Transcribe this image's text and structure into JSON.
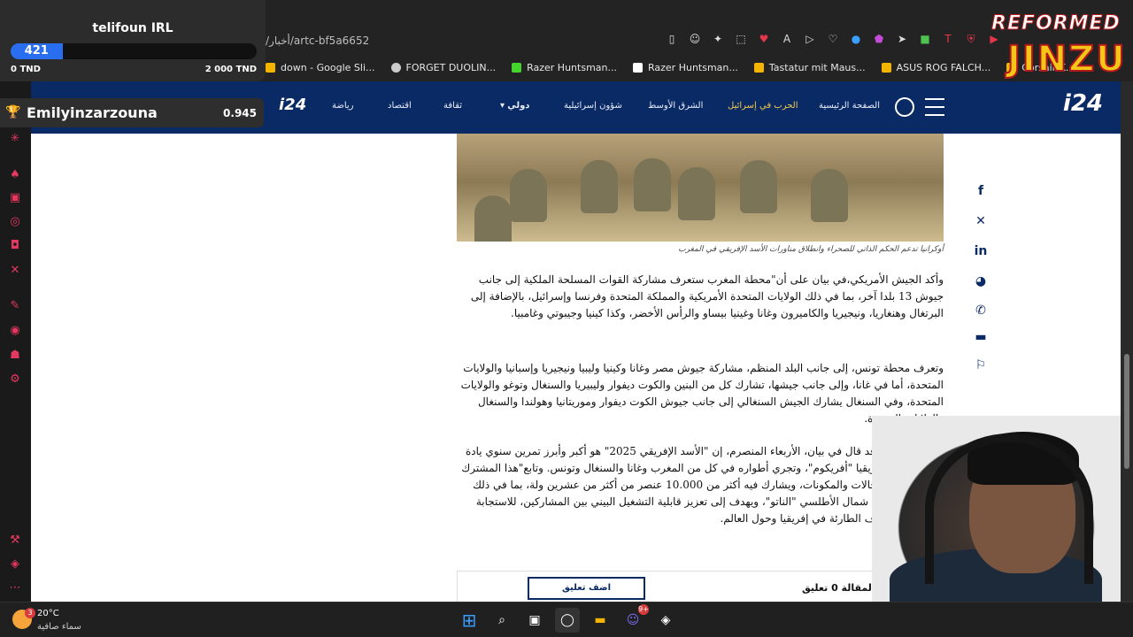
{
  "browser": {
    "address": "/أخبار/artc-bf5a6652",
    "bookmarks": [
      {
        "label": "down - Google Sli...",
        "color": "#f5b400"
      },
      {
        "label": "FORGET DUOLIN...",
        "color": "#cccccc"
      },
      {
        "label": "Razer Huntsman...",
        "color": "#44d62c"
      },
      {
        "label": "Razer Huntsman...",
        "color": "#ffffff"
      },
      {
        "label": "Tastatur mit Maus...",
        "color": "#f5b400"
      },
      {
        "label": "ASUS ROG FALCH...",
        "color": "#f5b400"
      },
      {
        "label": "Corsair K...",
        "color": "#f5b400"
      }
    ]
  },
  "sitenav": {
    "logo": "i24",
    "logo_small": "i24",
    "items": [
      {
        "label": "الصفحة الرئيسية",
        "active": false
      },
      {
        "label": "الحرب في إسرائيل",
        "active": true
      },
      {
        "label": "الشرق الأوسط",
        "active": false
      },
      {
        "label": "شؤون إسرائيلية",
        "active": false
      },
      {
        "label": "دولي",
        "active": false
      },
      {
        "label": "ثقافة",
        "active": false
      },
      {
        "label": "اقتصاد",
        "active": false
      },
      {
        "label": "رياضة",
        "active": false
      }
    ]
  },
  "article": {
    "caption": "أوكرانيا تدعم الحكم الذاتي للصحراء وانطلاق مناورات الأسد الإفريقي في المغرب",
    "paragraphs": [
      "وأكد الجيش الأمريكي،في بيان على أن\"محطة المغرب ستعرف مشاركة القوات المسلحة الملكية إلى جانب جيوش 13 بلدا آخر، بما في ذلك الولايات المتحدة الأمريكية والمملكة المتحدة وفرنسا وإسرائيل، بالإضافة إلى البرتغال وهنغاريا، ونيجيريا والكاميرون وغانا وغينيا بيساو والرأس الأخضر، وكذا كينيا وجيبوتي وغامبيا.",
      "وتعرف محطة تونس، إلى جانب البلد المنظم، مشاركة جيوش مصر وغانا وكينيا وليبيا ونيجيريا وإسبانيا والولايات المتحدة، أما في غانا، وإلى جانب جيشها، تشارك كل من البنين والكوت ديفوار وليبيريا والسنغال وتوغو والولايات المتحدة، وفي السنغال يشارك الجيش السنغالي إلى جانب جيوش الكوت ديفوار وموريتانيا وهولندا والسنغال والولايات المتحدة.",
      "جيش الأمريكي قد قال في بيان، الأربعاء المنصرم، إن \"الأسد الإفريقي 2025\" هو أكبر وأبرز تمرين سنوي يادة الأمريكية في إفريقيا \"أفريكوم\"، وتجري أطواره في كل من المغرب وغانا والسنغال وتونس. وتابع\"هذا المشترك يغطي جميع المجالات والمكونات، ويشارك فيه أكثر من 10.000 عنصر من أكثر من عشرين ولة، بما في ذلك وحدات من حلف شمال الأطلسي \"الناتو\"، ويهدف إلى تعزيز قابلية التشغيل البيني بين المشاركين، للاستجابة للأزمات والظروف الطارئة في إفريقيا وحول العالم."
    ],
    "comments": {
      "add_label": "اضف تعليق",
      "count_label": "تلقت هذه المقالة 0 تعليق"
    }
  },
  "share": [
    "facebook-icon",
    "x-icon",
    "linkedin-icon",
    "reddit-icon",
    "whatsapp-icon",
    "comment-icon",
    "bookmark-icon"
  ],
  "goal": {
    "title": "telifoun IRL",
    "current": "421",
    "fraction": 0.2105,
    "min_label": "0 TND",
    "max_label": "2 000 TND"
  },
  "top_donor": {
    "name": "Emilyinzarzouna",
    "amount": "0.945"
  },
  "brand": {
    "line1": "REFORMED",
    "line2": "JINZU"
  },
  "taskbar": {
    "weather_temp": "20°C",
    "weather_desc": "سماء صافية",
    "weather_badge": "3",
    "discord_badge": "9+"
  }
}
